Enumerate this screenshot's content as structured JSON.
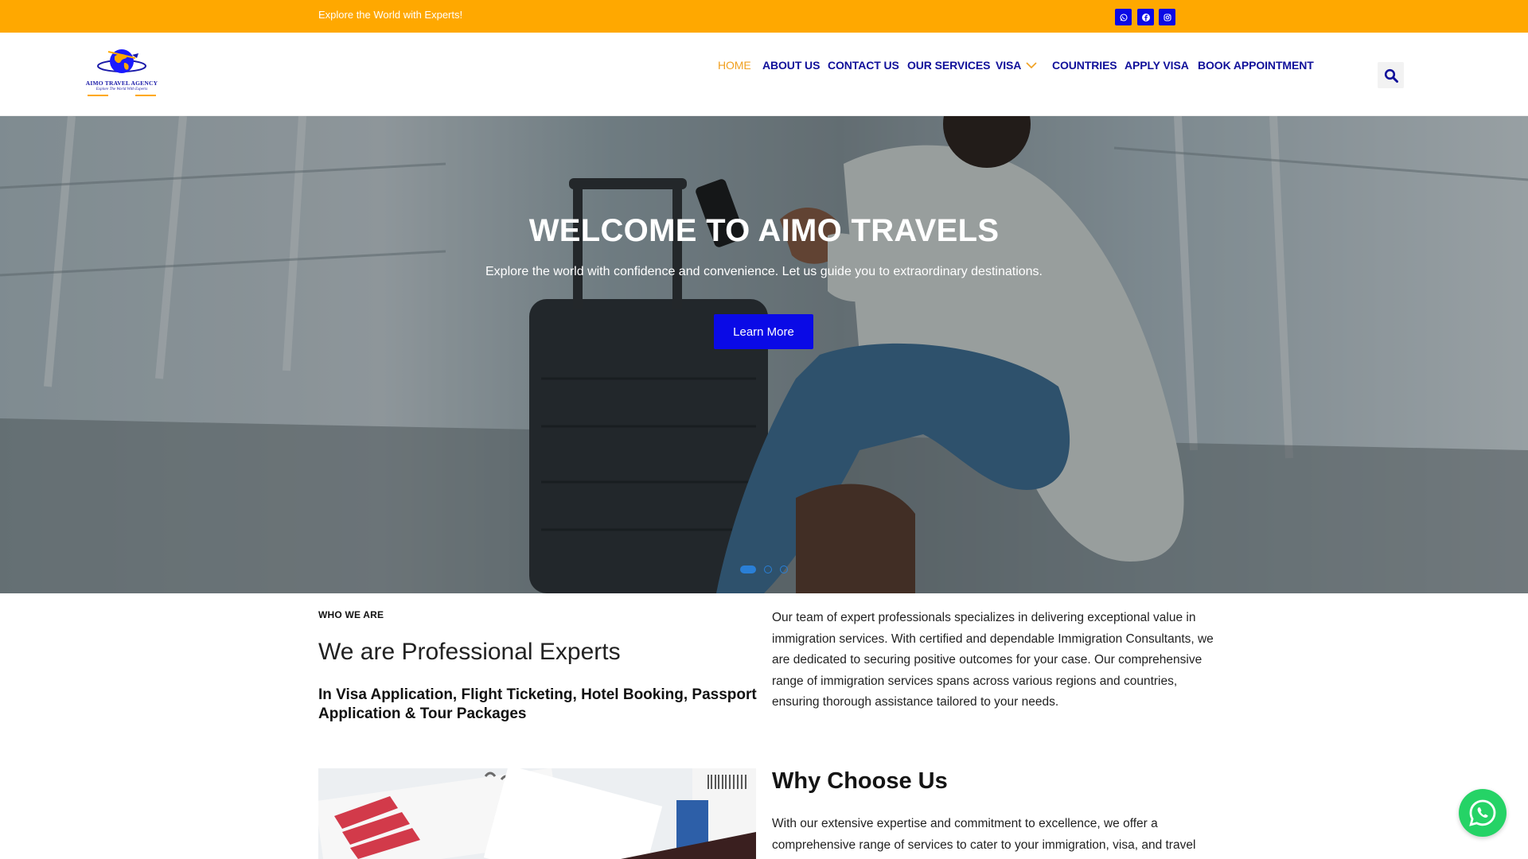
{
  "topbar": {
    "tagline": "Explore the World with Experts!",
    "social": [
      "whatsapp-icon",
      "facebook-icon",
      "instagram-icon"
    ],
    "bg_color": "#FFA800",
    "icon_bg_color": "#0A0AE6"
  },
  "logo": {
    "name": "AIMO TRAVEL AGENCY",
    "tagline": "Explore The World With Experts"
  },
  "nav": {
    "items": [
      {
        "label": "HOME",
        "active": true
      },
      {
        "label": "ABOUT US"
      },
      {
        "label": "CONTACT US"
      },
      {
        "label": "OUR SERVICES"
      },
      {
        "label": "VISA",
        "has_dropdown": true
      },
      {
        "label": "COUNTRIES"
      },
      {
        "label": "APPLY VISA"
      },
      {
        "label": "BOOK APPOINTMENT"
      }
    ],
    "color": "#10109A",
    "active_color": "#F0A020"
  },
  "hero": {
    "title": "WELCOME TO AIMO TRAVELS",
    "subtitle": "Explore the world with confidence and convenience. Let us guide you to extraordinary destinations.",
    "button_label": "Learn More",
    "slide_count": 3,
    "active_slide": 1
  },
  "about": {
    "eyebrow": "WHO WE ARE",
    "headline": "We are Professional Experts",
    "subhead": "In Visa Application, Flight Ticketing, Hotel Booking, Passport Application & Tour Packages",
    "body": "Our team of expert professionals specializes in delivering exceptional value in immigration services. With certified and dependable Immigration Consultants, we are dedicated to securing positive outcomes for your case. Our comprehensive range of immigration services spans across various regions and countries, ensuring thorough assistance tailored to your needs."
  },
  "why": {
    "title": "Why Choose Us",
    "body": "With our extensive expertise and commitment to excellence, we offer a comprehensive range of services to cater to your immigration, visa, and travel"
  },
  "floating": {
    "icon": "whatsapp-icon",
    "color": "#25D366"
  }
}
